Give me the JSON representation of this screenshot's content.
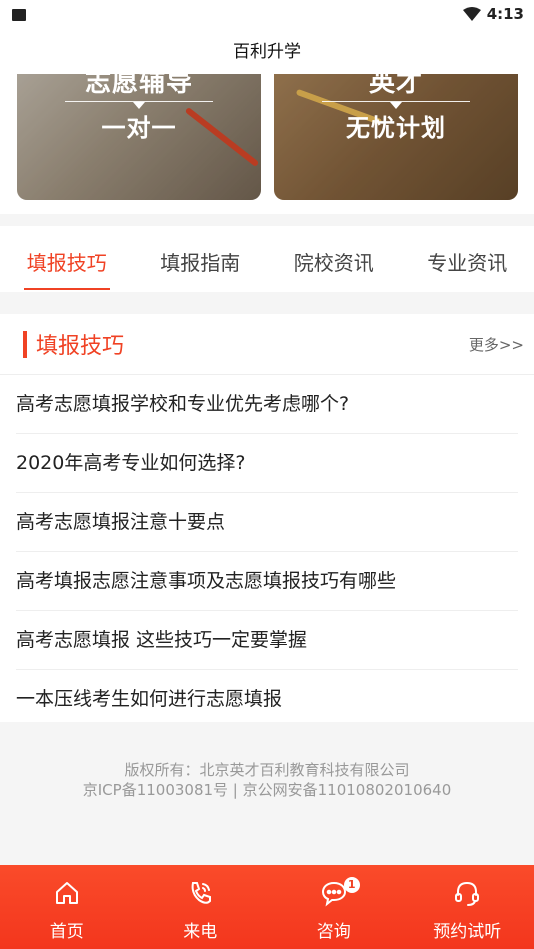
{
  "status_bar": {
    "time": "4:13",
    "icons": [
      "sim-icon",
      "wifi-icon"
    ]
  },
  "app_bar": {
    "title": "百利升学"
  },
  "banners": [
    {
      "line1": "志愿辅导",
      "line2": "一对一"
    },
    {
      "line1": "英才",
      "line2": "无忧计划"
    }
  ],
  "tabs": [
    {
      "label": "填报技巧",
      "active": true
    },
    {
      "label": "填报指南",
      "active": false
    },
    {
      "label": "院校资讯",
      "active": false
    },
    {
      "label": "专业资讯",
      "active": false
    }
  ],
  "section": {
    "title": "填报技巧",
    "more": "更多>>",
    "items": [
      "高考志愿填报学校和专业优先考虑哪个?",
      "2020年高考专业如何选择?",
      "高考志愿填报注意十要点",
      "高考填报志愿注意事项及志愿填报技巧有哪些",
      "高考志愿填报 这些技巧一定要掌握",
      "一本压线考生如何进行志愿填报"
    ]
  },
  "footer": {
    "line1": "版权所有：北京英才百利教育科技有限公司",
    "line2": "京ICP备11003081号 | 京公网安备11010802010640"
  },
  "bottom_nav": [
    {
      "label": "首页",
      "icon": "home-icon"
    },
    {
      "label": "来电",
      "icon": "phone-icon"
    },
    {
      "label": "咨询",
      "icon": "chat-icon",
      "badge": "1"
    },
    {
      "label": "预约试听",
      "icon": "headset-icon"
    }
  ],
  "colors": {
    "accent": "#f04224",
    "nav_bg": "#f3361d"
  }
}
